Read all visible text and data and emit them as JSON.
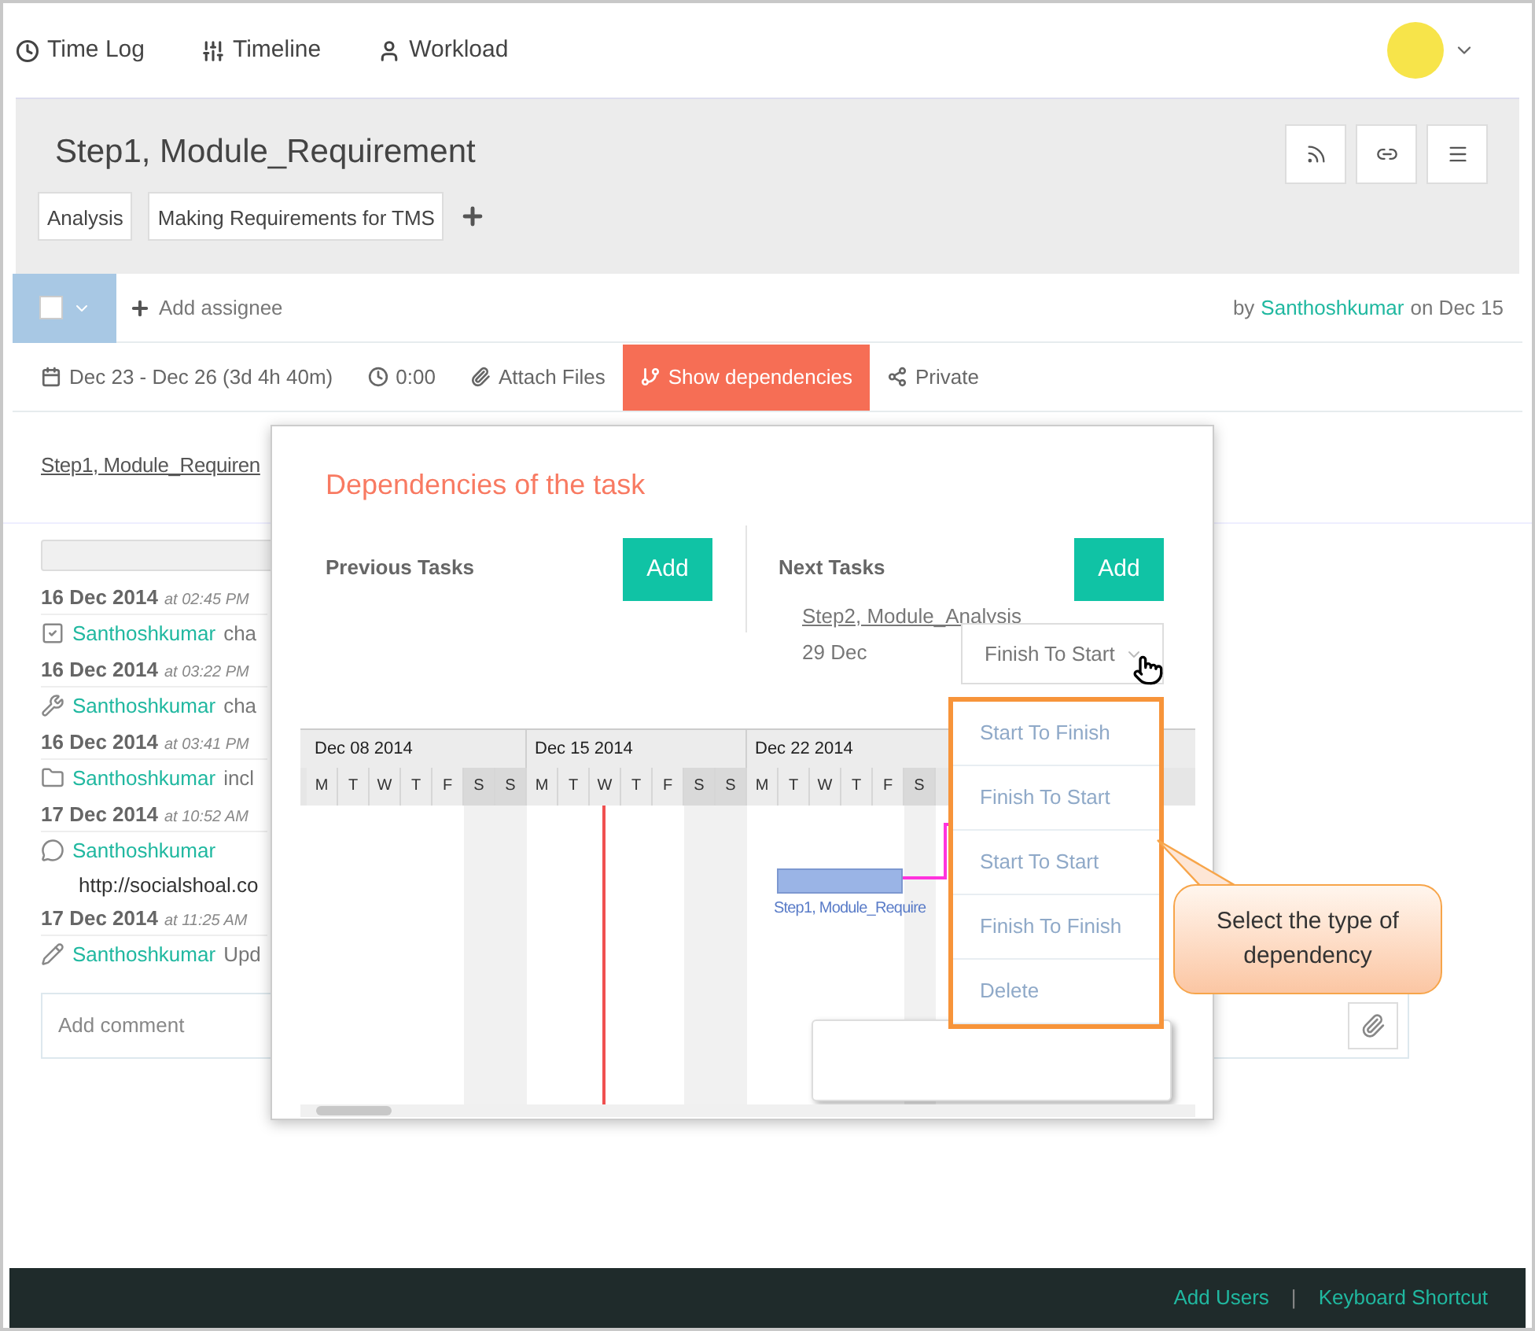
{
  "nav": [
    {
      "label": "Time Log"
    },
    {
      "label": "Timeline"
    },
    {
      "label": "Workload"
    }
  ],
  "task": {
    "title": "Step1, Module_Requirement",
    "tags": [
      "Analysis",
      "Making Requirements for TMS"
    ]
  },
  "assignee": {
    "add_label": "Add assignee",
    "by": "by",
    "author": "Santhoshkumar",
    "on": "on Dec 15"
  },
  "toolbar": [
    {
      "label": "Dec 23 - Dec 26 (3d 4h 40m)",
      "selected": false
    },
    {
      "label": "0:00",
      "selected": false
    },
    {
      "label": "Attach Files",
      "selected": false
    },
    {
      "label": "Show dependencies",
      "selected": true
    },
    {
      "label": "Private",
      "selected": false
    }
  ],
  "task_link": "Step1, Module_Requiren",
  "activity": [
    {
      "date": "16 Dec 2014",
      "time": "at 02:45 PM",
      "user": "Santhoshkumar",
      "text": "cha"
    },
    {
      "date": "16 Dec 2014",
      "time": "at 03:22 PM",
      "user": "Santhoshkumar",
      "text": "cha"
    },
    {
      "date": "16 Dec 2014",
      "time": "at 03:41 PM",
      "user": "Santhoshkumar",
      "text": "incl"
    },
    {
      "date": "17 Dec 2014",
      "time": "at 10:52 AM",
      "user": "Santhoshkumar",
      "detail": "http://socialshoal.co"
    },
    {
      "date": "17 Dec 2014",
      "time": "at 11:25 AM",
      "user": "Santhoshkumar",
      "text": "Upd"
    }
  ],
  "comment": {
    "placeholder": "Add comment"
  },
  "dependencies": {
    "title": "Dependencies of the task",
    "previous": {
      "heading": "Previous Tasks",
      "button": "Add"
    },
    "next": {
      "heading": "Next Tasks",
      "button": "Add",
      "task": "Step2, Module_Analysis",
      "date": "29 Dec",
      "type": "Finish To Start"
    },
    "gantt": {
      "weeks": [
        {
          "label": "Dec 08 2014",
          "days": [
            {
              "label": "M",
              "weekend": false
            },
            {
              "label": "T",
              "weekend": false
            },
            {
              "label": "W",
              "weekend": false
            },
            {
              "label": "T",
              "weekend": false
            },
            {
              "label": "F",
              "weekend": false
            },
            {
              "label": "S",
              "weekend": true
            },
            {
              "label": "S",
              "weekend": true
            }
          ]
        },
        {
          "label": "Dec 15 2014",
          "days": [
            {
              "label": "M",
              "weekend": false
            },
            {
              "label": "T",
              "weekend": false
            },
            {
              "label": "W",
              "weekend": false
            },
            {
              "label": "T",
              "weekend": false
            },
            {
              "label": "F",
              "weekend": false
            },
            {
              "label": "S",
              "weekend": true
            },
            {
              "label": "S",
              "weekend": true
            }
          ]
        },
        {
          "label": "Dec 22 2014",
          "days": [
            {
              "label": "M",
              "weekend": false
            },
            {
              "label": "T",
              "weekend": false
            },
            {
              "label": "W",
              "weekend": false
            },
            {
              "label": "T",
              "weekend": false
            },
            {
              "label": "F",
              "weekend": false
            },
            {
              "label": "S",
              "weekend": true
            }
          ]
        }
      ],
      "bar_label": "Step1, Module_Require"
    },
    "type_options": [
      "Start To Finish",
      "Finish To Start",
      "Start To Start",
      "Finish To Finish",
      "Delete"
    ]
  },
  "callout": "Select the type of dependency",
  "footer": {
    "links": [
      "Add Users",
      "Keyboard Shortcut"
    ],
    "separator": "|"
  }
}
